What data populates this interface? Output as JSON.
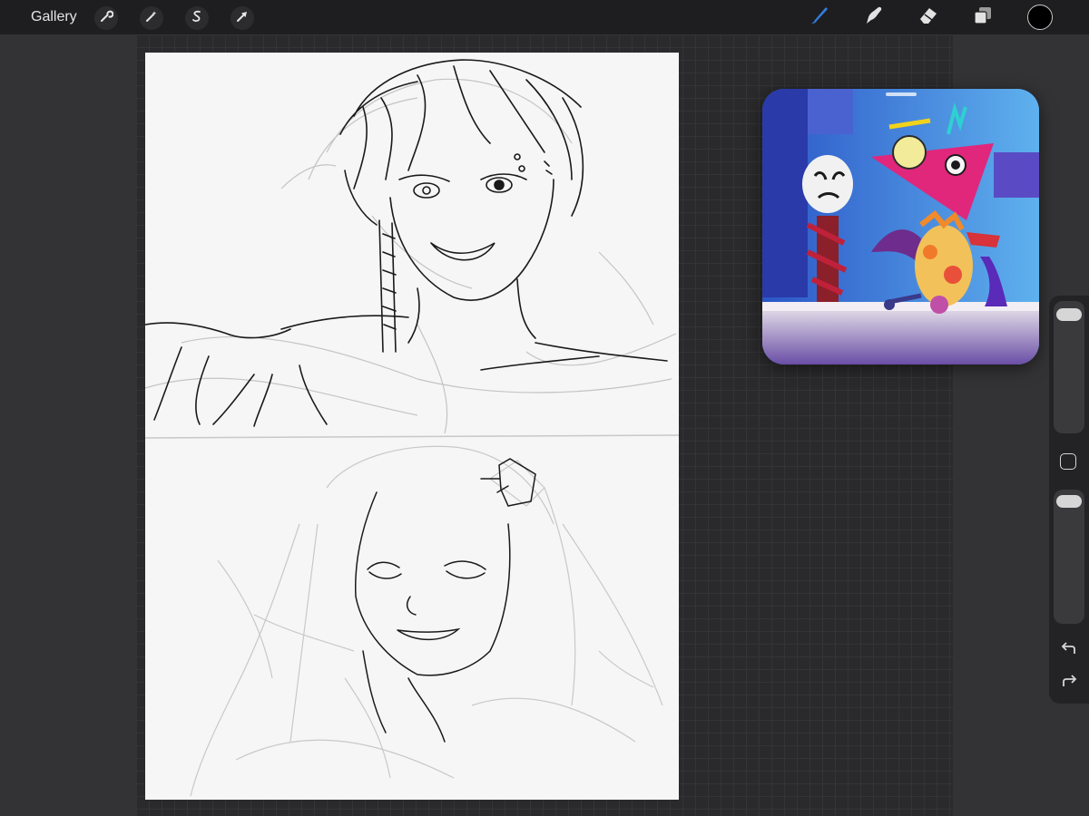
{
  "topbar": {
    "gallery_label": "Gallery",
    "left_tools": [
      {
        "name": "actions",
        "icon": "wrench-icon"
      },
      {
        "name": "adjustments",
        "icon": "magic-wand-icon"
      },
      {
        "name": "selection",
        "icon": "selection-s-icon"
      },
      {
        "name": "transform",
        "icon": "arrow-cursor-icon"
      }
    ],
    "right_tools": [
      {
        "name": "brush",
        "icon": "brush-icon",
        "active": true
      },
      {
        "name": "smudge",
        "icon": "smudge-icon",
        "active": false
      },
      {
        "name": "eraser",
        "icon": "eraser-icon",
        "active": false
      },
      {
        "name": "layers",
        "icon": "layers-icon",
        "active": false
      }
    ],
    "current_color": "#000000",
    "active_color": "#2f7fe0"
  },
  "canvas": {
    "background": "#f6f6f6",
    "panels": [
      "sketch-top",
      "sketch-bottom"
    ]
  },
  "reference_window": {
    "content": "reference-image"
  },
  "sidebar": {
    "brush_size_level": 0.05,
    "opacity_level": 0.05,
    "modify_icon": "square-modify-icon",
    "undo_icon": "undo-icon",
    "redo_icon": "redo-icon"
  }
}
